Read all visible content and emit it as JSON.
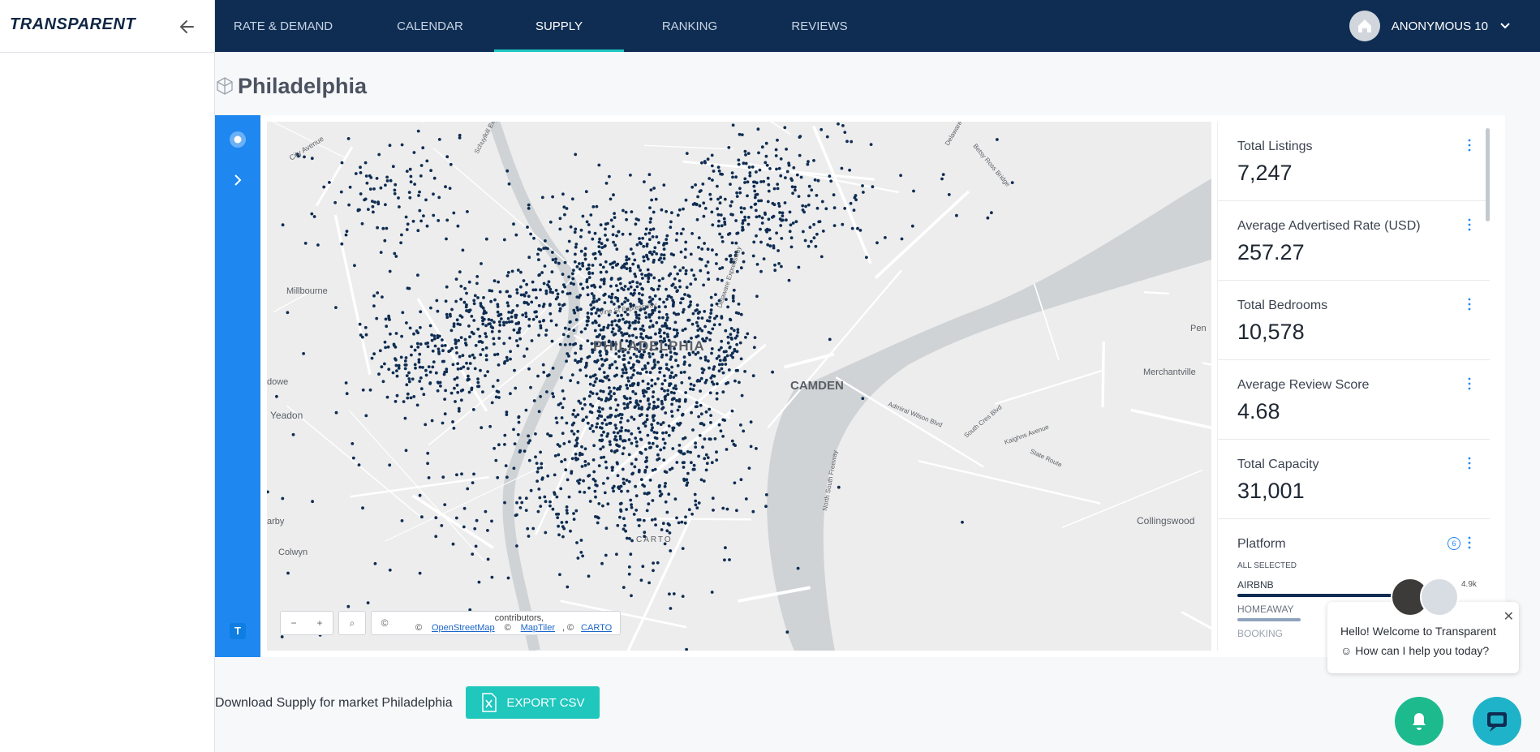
{
  "brand": "TRANSPARENT",
  "nav": {
    "tabs": [
      {
        "label": "RATE & DEMAND"
      },
      {
        "label": "CALENDAR"
      },
      {
        "label": "SUPPLY"
      },
      {
        "label": "RANKING"
      },
      {
        "label": "REVIEWS"
      }
    ],
    "active_tab": "SUPPLY",
    "user": "ANONYMOUS 10"
  },
  "page": {
    "title": "Philadelphia"
  },
  "map": {
    "labels": [
      "PHILADELPHIA",
      "CAMDEN",
      "Millbourne",
      "Yeadon",
      "Colwyn",
      "Merchantville",
      "Collingswood",
      "City Avenue",
      "Pen",
      "dowe",
      "arby"
    ],
    "roads": [
      "Schuylkill Expressway",
      "Delaware Expressway",
      "Vine St Expressway",
      "Admiral Wilson Blvd",
      "South Cres Blvd",
      "Kaighns Avenue",
      "State Route",
      "North South Freeway",
      "Betsy Ross Bridge",
      "Delaware Riv"
    ],
    "watermark": "CARTO",
    "attribution": {
      "prefix": "© ",
      "osm": "OpenStreetMap",
      "middle": " contributors, © ",
      "maptiler": "MapTiler",
      "sep": ", © ",
      "carto": "CARTO"
    },
    "controls": {
      "zoom_out": "−",
      "zoom_in": "+",
      "search": "⌕",
      "info": "©"
    }
  },
  "stats": [
    {
      "label": "Total Listings",
      "value": "7,247"
    },
    {
      "label": "Average Advertised Rate (USD)",
      "value": "257.27"
    },
    {
      "label": "Total Bedrooms",
      "value": "10,578"
    },
    {
      "label": "Average Review Score",
      "value": "4.68"
    },
    {
      "label": "Total Capacity",
      "value": "31,001"
    }
  ],
  "platform": {
    "label": "Platform",
    "badge": "6",
    "all_selected": "ALL SELECTED",
    "items": [
      {
        "name": "AIRBNB",
        "value": "4.9k",
        "share": 0.85
      },
      {
        "name": "HOMEAWAY",
        "value": "",
        "share": 0.29
      },
      {
        "name": "BOOKING",
        "value": "",
        "share": 0.1
      }
    ]
  },
  "download": {
    "text": "Download Supply for market Philadelphia",
    "button": "EXPORT CSV"
  },
  "chat": {
    "line1": "Hello! Welcome to Transparent",
    "line2": "How can I help you today?"
  },
  "colors": {
    "nav_bg": "#0f2d52",
    "accent": "#1ec6c1",
    "rail": "#1e88f0",
    "dot": "#0f2d52",
    "export": "#1fc7bd"
  }
}
